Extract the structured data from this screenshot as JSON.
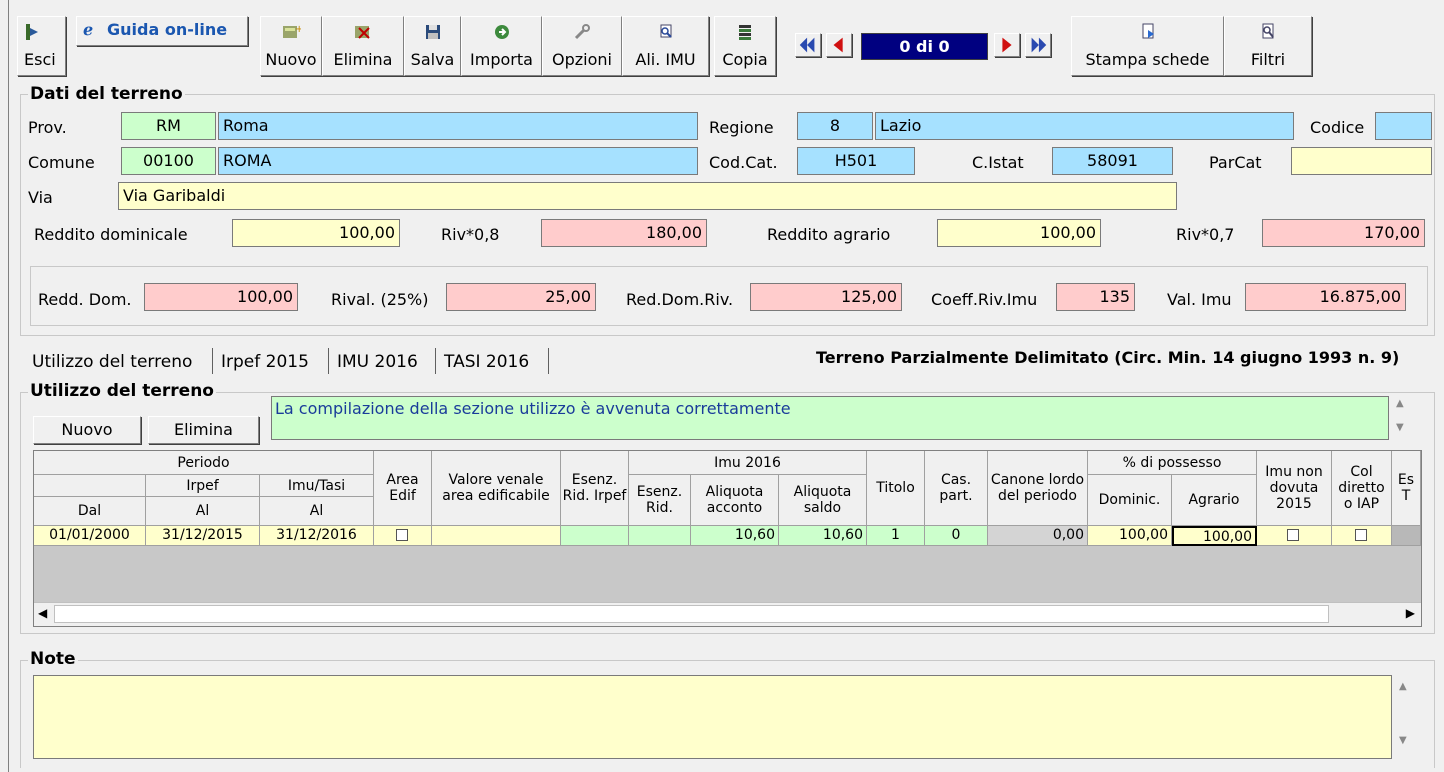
{
  "toolbar": {
    "esci": "Esci",
    "guida": "Guida on-line",
    "nuovo": "Nuovo",
    "elimina": "Elimina",
    "salva": "Salva",
    "importa": "Importa",
    "opzioni": "Opzioni",
    "ali_imu": "Ali. IMU",
    "copia": "Copia",
    "record_counter": "0 di 0",
    "stampa": "Stampa schede",
    "filtri": "Filtri"
  },
  "dati": {
    "title": "Dati del terreno",
    "prov_label": "Prov.",
    "prov_code": "RM",
    "prov_name": "Roma",
    "regione_label": "Regione",
    "regione_code": "8",
    "regione_name": "Lazio",
    "codice_label": "Codice",
    "codice_value": "",
    "comune_label": "Comune",
    "comune_cap": "00100",
    "comune_name": "ROMA",
    "codcat_label": "Cod.Cat.",
    "codcat_value": "H501",
    "cistat_label": "C.Istat",
    "cistat_value": "58091",
    "parcat_label": "ParCat",
    "parcat_value": "",
    "via_label": "Via",
    "via_value": "Via Garibaldi",
    "rd_label": "Reddito dominicale",
    "rd_value": "100,00",
    "riv08_label": "Riv*0,8",
    "riv08_value": "180,00",
    "ra_label": "Reddito agrario",
    "ra_value": "100,00",
    "riv07_label": "Riv*0,7",
    "riv07_value": "170,00",
    "redddom_label": "Redd. Dom.",
    "redddom_value": "100,00",
    "rival_label": "Rival. (25%)",
    "rival_value": "25,00",
    "reddomriv_label": "Red.Dom.Riv.",
    "reddomriv_value": "125,00",
    "coeff_label": "Coeff.Riv.Imu",
    "coeff_value": "135",
    "valimu_label": "Val. Imu",
    "valimu_value": "16.875,00"
  },
  "tabs": [
    "Utilizzo del terreno",
    "Irpef 2015",
    "IMU 2016",
    "TASI 2016"
  ],
  "tab_caption": "Terreno Parzialmente Delimitato (Circ. Min. 14 giugno 1993 n. 9)",
  "utilizzo": {
    "title": "Utilizzo del terreno",
    "nuovo": "Nuovo",
    "elimina": "Elimina",
    "message": "La compilazione della sezione utilizzo è avvenuta correttamente"
  },
  "grid": {
    "h_periodo": "Periodo",
    "h_irpef": "Irpef",
    "h_imutasi": "Imu/Tasi",
    "h_dal": "Dal",
    "h_al1": "Al",
    "h_al2": "Al",
    "h_area": "Area Edif",
    "h_valore": "Valore venale area edificabile",
    "h_esenz": "Esenz. Rid. Irpef",
    "h_imu2016": "Imu 2016",
    "h_esenzrid": "Esenz. Rid.",
    "h_aliqacc": "Aliquota acconto",
    "h_aliqsaldo": "Aliquota saldo",
    "h_titolo": "Titolo",
    "h_cas": "Cas. part.",
    "h_canone": "Canone lordo del periodo",
    "h_possesso": "% di possesso",
    "h_dominic": "Dominic.",
    "h_agrario": "Agrario",
    "h_imunon": "Imu non dovuta 2015",
    "h_col": "Col diretto o IAP",
    "h_es": "Es T",
    "row": {
      "dal": "01/01/2000",
      "al_irpef": "31/12/2015",
      "al_imu": "31/12/2016",
      "valore": "",
      "esenz": "",
      "esenzrid": "",
      "aliq_acconto": "10,60",
      "aliq_saldo": "10,60",
      "titolo": "1",
      "cas": "0",
      "canone": "0,00",
      "dominic": "100,00",
      "agrario": "100,00"
    }
  },
  "note": {
    "title": "Note",
    "value": ""
  }
}
